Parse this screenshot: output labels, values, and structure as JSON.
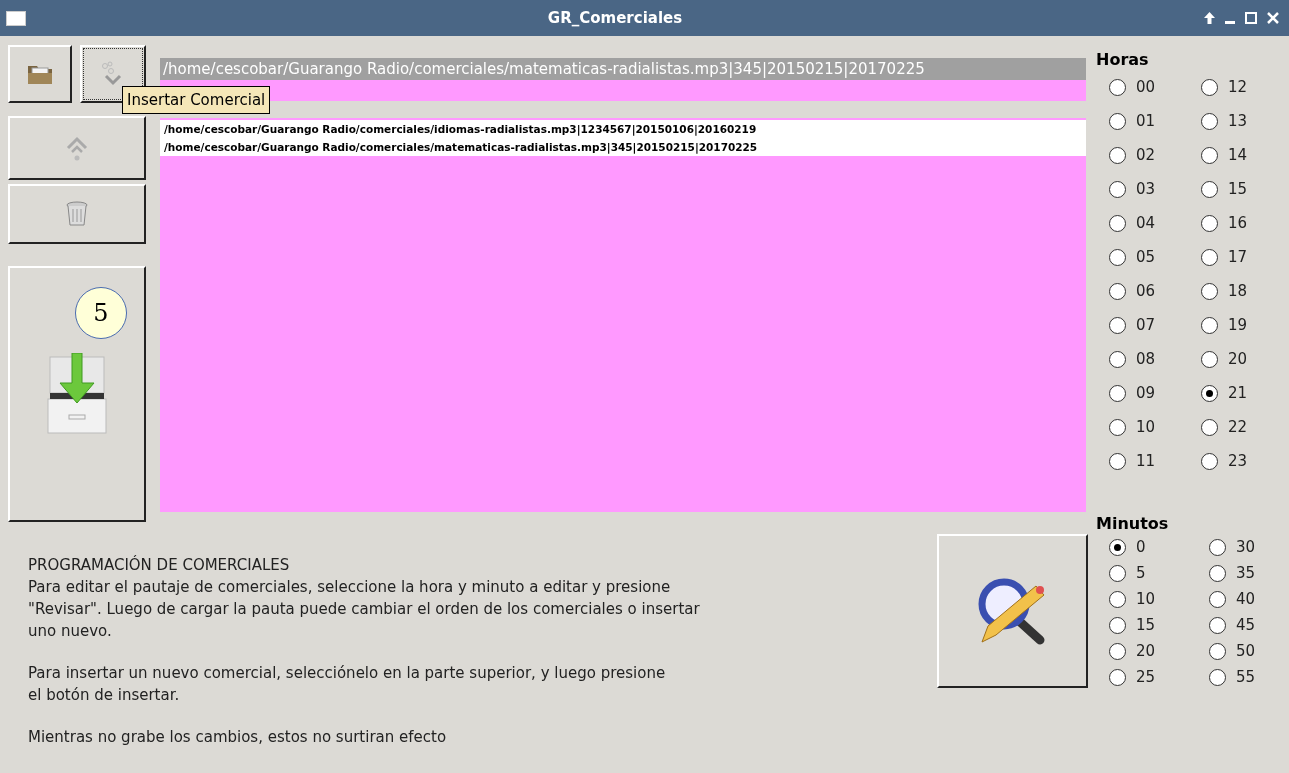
{
  "window": {
    "title": "GR_Comerciales"
  },
  "toolbar": [
    {
      "kind": "open",
      "focused": false
    },
    {
      "kind": "insert",
      "focused": true
    },
    {
      "kind": "up",
      "focused": false
    },
    {
      "kind": "delete",
      "focused": false
    },
    {
      "kind": "save",
      "focused": false
    }
  ],
  "tooltip": "Insertar Comercial",
  "badge": "5",
  "file_list": [
    {
      "text": "/home/cescobar/Guarango Radio/comerciales/matematicas-radialistas.mp3|345|20150215|20170225",
      "selected": true
    }
  ],
  "schedule_list": [
    {
      "text": "/home/cescobar/Guarango Radio/comerciales/idiomas-radialistas.mp3|1234567|20150106|20160219",
      "selected": false
    },
    {
      "text": "/home/cescobar/Guarango Radio/comerciales/matematicas-radialistas.mp3|345|20150215|20170225",
      "selected": false
    }
  ],
  "description": {
    "heading": "PROGRAMACIÓN DE COMERCIALES",
    "paragraphs": [
      [
        "Para editar el pautaje de comerciales, seleccione la hora y minuto a editar y presione",
        "\"Revisar\". Luego de cargar la pauta puede cambiar el orden de los comerciales o insertar",
        "uno nuevo."
      ],
      [
        "Para insertar un nuevo comercial, selecciónelo en la parte superior, y luego presione",
        "el botón de insertar."
      ],
      [
        "Mientras no grabe los cambios, estos no surtiran efecto"
      ]
    ]
  },
  "hours": {
    "label": "Horas",
    "options": [
      {
        "label": "00",
        "selected": false
      },
      {
        "label": "01",
        "selected": false
      },
      {
        "label": "02",
        "selected": false
      },
      {
        "label": "03",
        "selected": false
      },
      {
        "label": "04",
        "selected": false
      },
      {
        "label": "05",
        "selected": false
      },
      {
        "label": "06",
        "selected": false
      },
      {
        "label": "07",
        "selected": false
      },
      {
        "label": "08",
        "selected": false
      },
      {
        "label": "09",
        "selected": false
      },
      {
        "label": "10",
        "selected": false
      },
      {
        "label": "11",
        "selected": false
      },
      {
        "label": "12",
        "selected": false
      },
      {
        "label": "13",
        "selected": false
      },
      {
        "label": "14",
        "selected": false
      },
      {
        "label": "15",
        "selected": false
      },
      {
        "label": "16",
        "selected": false
      },
      {
        "label": "17",
        "selected": false
      },
      {
        "label": "18",
        "selected": false
      },
      {
        "label": "19",
        "selected": false
      },
      {
        "label": "20",
        "selected": false
      },
      {
        "label": "21",
        "selected": true
      },
      {
        "label": "22",
        "selected": false
      },
      {
        "label": "23",
        "selected": false
      }
    ]
  },
  "minutes": {
    "label": "Minutos",
    "options": [
      {
        "label": "0",
        "selected": true
      },
      {
        "label": "5",
        "selected": false
      },
      {
        "label": "10",
        "selected": false
      },
      {
        "label": "15",
        "selected": false
      },
      {
        "label": "20",
        "selected": false
      },
      {
        "label": "25",
        "selected": false
      },
      {
        "label": "30",
        "selected": false
      },
      {
        "label": "35",
        "selected": false
      },
      {
        "label": "40",
        "selected": false
      },
      {
        "label": "45",
        "selected": false
      },
      {
        "label": "50",
        "selected": false
      },
      {
        "label": "55",
        "selected": false
      }
    ]
  }
}
